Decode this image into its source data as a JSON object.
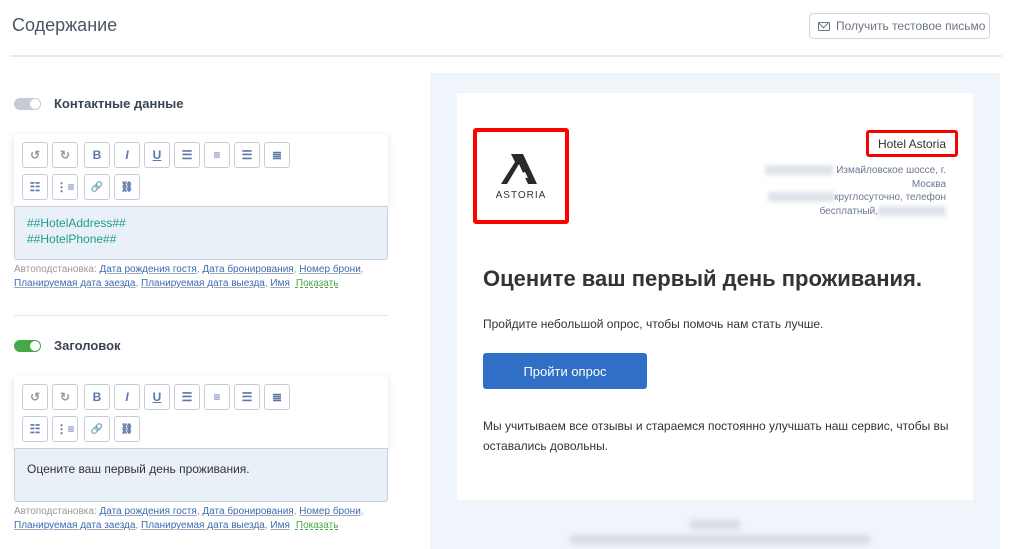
{
  "header": {
    "title": "Содержание",
    "test_button": "Получить тестовое письмо"
  },
  "sections": [
    {
      "label": "Контактные данные",
      "enabled": false,
      "content": [
        "##HotelAddress##",
        "##HotelPhone##"
      ]
    },
    {
      "label": "Заголовок",
      "enabled": true,
      "content": [
        "Оцените ваш первый день проживания."
      ]
    }
  ],
  "toolbar": {
    "buttons": [
      "undo",
      "redo",
      "bold",
      "italic",
      "underline",
      "align-left",
      "align-center",
      "align-right",
      "justify",
      "bullet-list",
      "numbered-list",
      "link",
      "unlink"
    ]
  },
  "autosub": {
    "label": "Автоподстановка:",
    "links": [
      "Дата рождения гостя",
      "Дата бронирования",
      "Номер брони",
      "Планируемая дата заезда",
      "Планируемая дата выезда",
      "Имя"
    ],
    "show": "Показать"
  },
  "email": {
    "logo_text": "ASTORIA",
    "hotel_name": "Hotel Astoria",
    "address_lines": [
      "Измайловское шоссе, г.",
      "Москва",
      "круглосуточно, телефон",
      "бесплатный,"
    ],
    "heading": "Оцените ваш первый день проживания.",
    "intro": "Пройдите небольшой опрос, чтобы помочь нам стать лучше.",
    "button": "Пройти опрос",
    "outro": "Мы учитываем все отзывы и стараемся постоянно улучшать наш сервис, чтобы вы оставались довольны."
  },
  "colors": {
    "accent": "#2f6fc5",
    "toggle_on": "#47a84a",
    "highlight": "#ff0000",
    "placeholder_text": "#1a9e8f"
  }
}
